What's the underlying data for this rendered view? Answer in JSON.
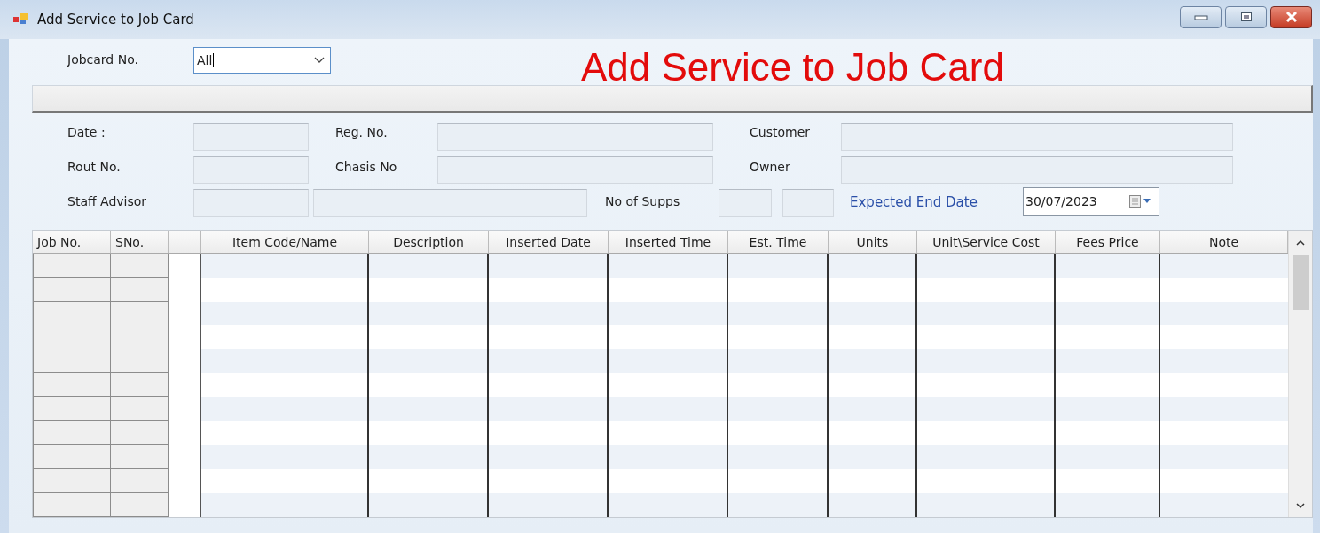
{
  "window": {
    "title": "Add Service to Job Card"
  },
  "jobcard": {
    "label": "Jobcard No.",
    "value": "All"
  },
  "heading": "Add Service to Job Card",
  "details": [
    [
      {
        "kind": "label",
        "text": "Date :"
      },
      {
        "kind": "field"
      },
      {
        "kind": "label",
        "text": "Reg. No."
      },
      {
        "kind": "field"
      },
      {
        "kind": "label",
        "text": "Customer"
      },
      {
        "kind": "field"
      }
    ],
    [
      {
        "kind": "label",
        "text": "Rout No."
      },
      {
        "kind": "field"
      },
      {
        "kind": "label",
        "text": "Chasis No"
      },
      {
        "kind": "field"
      },
      {
        "kind": "label",
        "text": "Owner"
      },
      {
        "kind": "field"
      }
    ],
    [
      {
        "kind": "label",
        "text": "Staff Advisor"
      },
      {
        "kind": "field"
      },
      {
        "kind": "field"
      },
      {
        "kind": "label",
        "text": "No of Supps"
      },
      {
        "kind": "field"
      },
      {
        "kind": "field"
      },
      {
        "kind": "link",
        "text": "Expected End Date"
      },
      {
        "kind": "date",
        "value": "30/07/2023"
      }
    ]
  ],
  "table": {
    "columns": [
      "Job No.",
      "SNo.",
      "",
      "Item Code/Name",
      "Description",
      "Inserted  Date",
      "Inserted Time",
      "Est. Time",
      "Units",
      "Unit\\Service Cost",
      "Fees Price",
      "Note"
    ]
  }
}
